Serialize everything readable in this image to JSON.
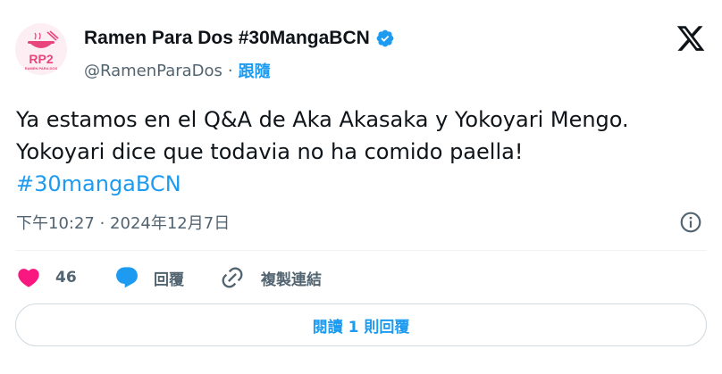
{
  "author": {
    "display_name": "Ramen Para Dos #30MangaBCN",
    "handle": "@RamenParaDos",
    "separator": "·",
    "follow_label": "跟隨",
    "avatar_text": "RP2",
    "avatar_subtext": "RAMEN PARA DOS"
  },
  "tweet": {
    "line1": "Ya estamos en el Q&A de Aka Akasaka y Yokoyari Mengo.",
    "line2": "Yokoyari dice que todavia no ha comido paella!",
    "hashtag": "#30mangaBCN"
  },
  "meta": {
    "timestamp": "下午10:27 · 2024年12月7日"
  },
  "actions": {
    "like_count": "46",
    "reply_label": "回覆",
    "copy_link_label": "複製連結"
  },
  "read_replies_label": "閱讀 1 則回覆",
  "colors": {
    "accent": "#1d9bf0",
    "like": "#f91880",
    "muted": "#536471",
    "avatar_pink": "#e8457c"
  },
  "icons": {
    "verified": "verified-badge-icon",
    "x_logo": "x-logo-icon",
    "info": "info-icon",
    "like": "heart-icon",
    "reply": "reply-bubble-icon",
    "copy_link": "link-icon"
  }
}
